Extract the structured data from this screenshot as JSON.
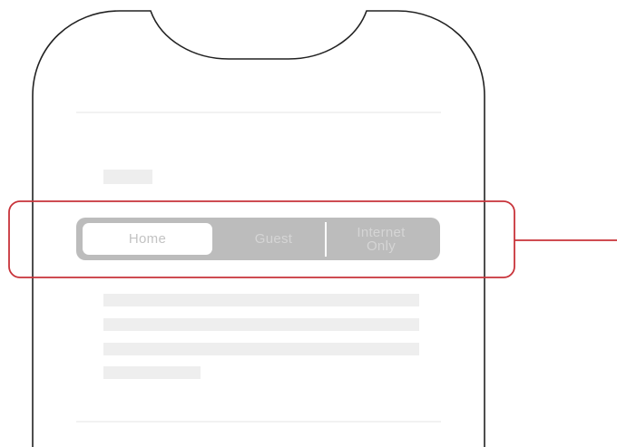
{
  "segmented_control": {
    "options": [
      "Home",
      "Guest",
      "Internet\nOnly"
    ],
    "selected": "Home"
  },
  "colors": {
    "callout": "#c8333a",
    "phone_outline": "#222222",
    "segment_track": "#bcbcbc",
    "placeholder": "#eeeeee"
  }
}
